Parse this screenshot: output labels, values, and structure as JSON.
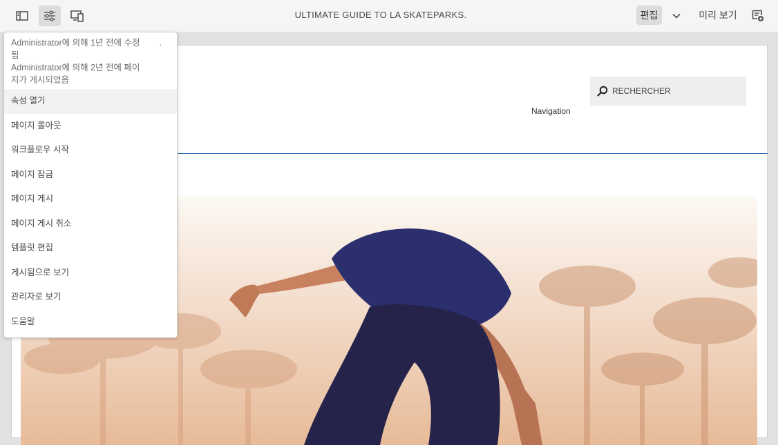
{
  "toolbar": {
    "page_title": "ULTIMATE GUIDE TO LA SKATEPARKS.",
    "mode_label": "편집",
    "preview_label": "미리 보기",
    "icons": [
      "side-panel-icon",
      "page-info-icon",
      "emulator-icon",
      "chevron-down-icon",
      "annotate-icon"
    ]
  },
  "menu": {
    "modified_text": "Administrator에 의해 1년 전에 수정됨",
    "modified_line1": "Administrator에 의해 1년 전에 수정",
    "modified_line2": "됨",
    "published_line1": "Administrator에 의해 2년 전에 페이",
    "published_line2": "지가 게시되었음",
    "dot": ".",
    "items": [
      "속성 열기",
      "페이지 롤아웃",
      "워크플로우 시작",
      "페이지 잠금",
      "페이지 게시",
      "페이지 게시 취소",
      "템플릿 편집",
      "게시됨으로 보기",
      "관리자로 보기",
      "도움말"
    ]
  },
  "page": {
    "search_placeholder": "RECHERCHER",
    "navigation_label": "Navigation"
  },
  "colors": {
    "toolbar_bg": "#f5f5f5",
    "canvas_bg": "#e1e1e1",
    "selection_border": "#2b6cb0",
    "menu_hover": "#f2f2f2",
    "shirt": "#2b2f6e",
    "pants": "#26234a"
  }
}
